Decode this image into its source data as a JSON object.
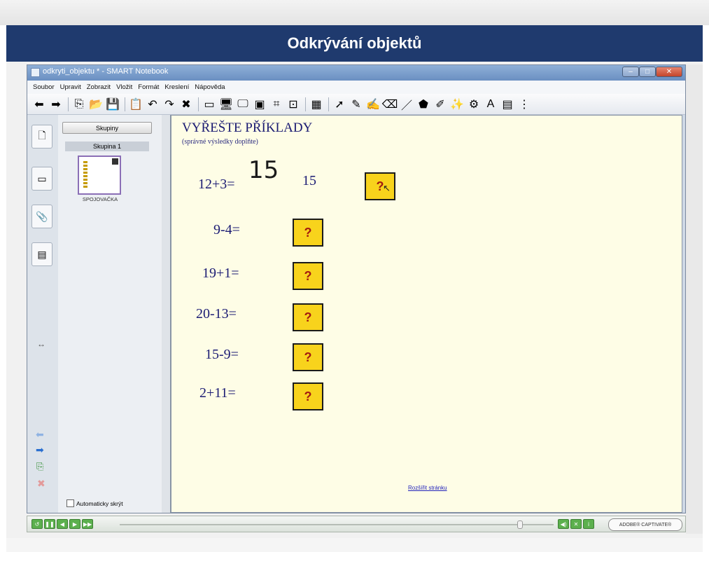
{
  "banner": {
    "title": "Odkrývání objektů"
  },
  "window": {
    "title": "odkryti_objektu * - SMART Notebook"
  },
  "menu": [
    "Soubor",
    "Upravit",
    "Zobrazit",
    "Vložit",
    "Formát",
    "Kreslení",
    "Nápověda"
  ],
  "toolbar": {
    "icons": [
      "back-arrow-icon",
      "forward-arrow-icon",
      "new-page-icon",
      "open-folder-icon",
      "save-icon",
      "paste-icon",
      "undo-icon",
      "redo-icon",
      "delete-icon",
      "screen-shade-icon",
      "display-icon",
      "monitor-icon",
      "capture-icon",
      "table-insert-icon",
      "document-camera-icon",
      "grid-icon",
      "select-pointer-icon",
      "pen-icon",
      "creative-pen-icon",
      "eraser-icon",
      "line-icon",
      "shape-icon",
      "fill-icon",
      "magic-pen-icon",
      "recognition-icon",
      "text-icon",
      "properties-icon",
      "more-icon"
    ],
    "glyphs": [
      "⬅",
      "➡",
      "⎘",
      "📂",
      "💾",
      "📋",
      "↶",
      "↷",
      "✖",
      "▭",
      "🖥",
      "🖵",
      "▣",
      "⌗",
      "⊡",
      "▦",
      "➚",
      "✎",
      "✍",
      "⌫",
      "／",
      "⬟",
      "✐",
      "✨",
      "⚙",
      "A",
      "▤",
      "⋮"
    ]
  },
  "sidebar": {
    "tabs": [
      {
        "name": "page-sorter-tab",
        "glyph": "🗋"
      },
      {
        "name": "gallery-tab",
        "glyph": "▭"
      },
      {
        "name": "attachments-tab",
        "glyph": "📎"
      },
      {
        "name": "properties-tab",
        "glyph": "▤"
      }
    ],
    "groups_button": "Skupiny",
    "group_label": "Skupina 1",
    "thumbnail_label": "SPOJOVAČKA",
    "auto_hide_label": "Automaticky skrýt"
  },
  "canvas": {
    "heading": "VYŘEŠTE PŘÍKLADY",
    "subheading": "(správné výsledky doplňte)",
    "handwritten_answer": "15",
    "typed_answer": "15",
    "box_label": "?",
    "problems": [
      "12+3=",
      "9-4=",
      "19+1=",
      "20-13=",
      "15-9=",
      "2+11="
    ],
    "page_link": "Rozšířit stránku"
  },
  "player": {
    "brand": "ADOBE® CAPTIVATE®"
  }
}
